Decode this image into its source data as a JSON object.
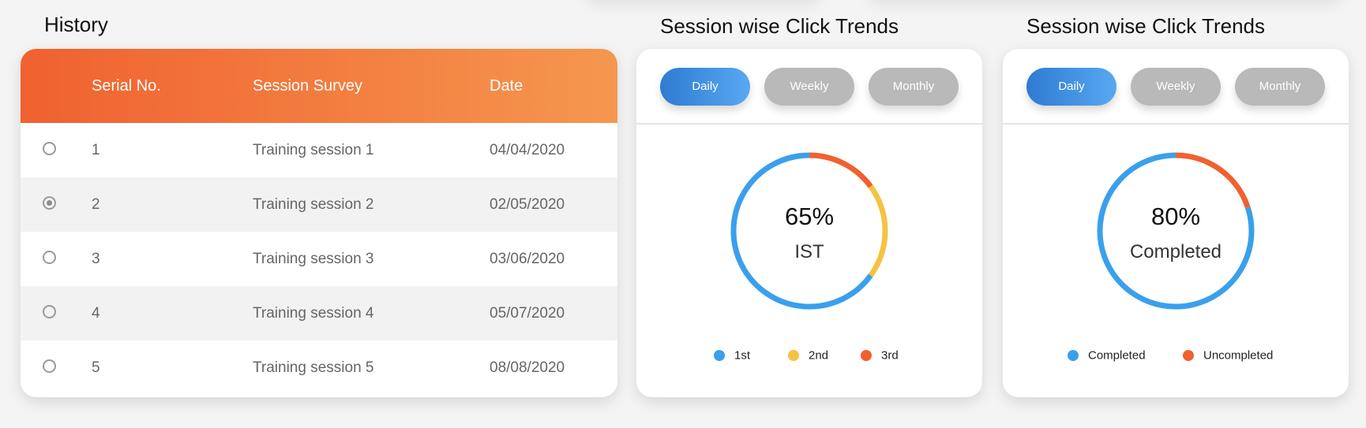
{
  "history": {
    "title": "History",
    "columns": [
      "Serial No.",
      "Session Survey",
      "Date"
    ],
    "rows": [
      {
        "serial": "1",
        "survey": "Training session 1",
        "date": "04/04/2020",
        "selected": false
      },
      {
        "serial": "2",
        "survey": "Training session 2",
        "date": "02/05/2020",
        "selected": true
      },
      {
        "serial": "3",
        "survey": "Training session 3",
        "date": "03/06/2020",
        "selected": false
      },
      {
        "serial": "4",
        "survey": "Training session 4",
        "date": "05/07/2020",
        "selected": false
      },
      {
        "serial": "5",
        "survey": "Training session 5",
        "date": "08/08/2020",
        "selected": false
      }
    ]
  },
  "trends": [
    {
      "title": "Session wise Click Trends",
      "tabs": [
        "Daily",
        "Weekly",
        "Monthly"
      ],
      "active_tab": "Daily",
      "center_value": "65%",
      "center_label": "IST",
      "legend": [
        "1st",
        "2nd",
        "3rd"
      ]
    },
    {
      "title": "Session wise Click Trends",
      "tabs": [
        "Daily",
        "Weekly",
        "Monthly"
      ],
      "active_tab": "Daily",
      "center_value": "80%",
      "center_label": "Completed",
      "legend": [
        "Completed",
        "Uncompleted"
      ]
    }
  ],
  "chart_data": [
    {
      "type": "pie",
      "categories": [
        "1st",
        "2nd",
        "3rd"
      ],
      "values": [
        65,
        20,
        15
      ],
      "colors": [
        "#3aa0ec",
        "#f5c242",
        "#f0612f"
      ]
    },
    {
      "type": "pie",
      "categories": [
        "Completed",
        "Uncompleted"
      ],
      "values": [
        80,
        20
      ],
      "colors": [
        "#3aa0ec",
        "#f0612f"
      ]
    }
  ]
}
